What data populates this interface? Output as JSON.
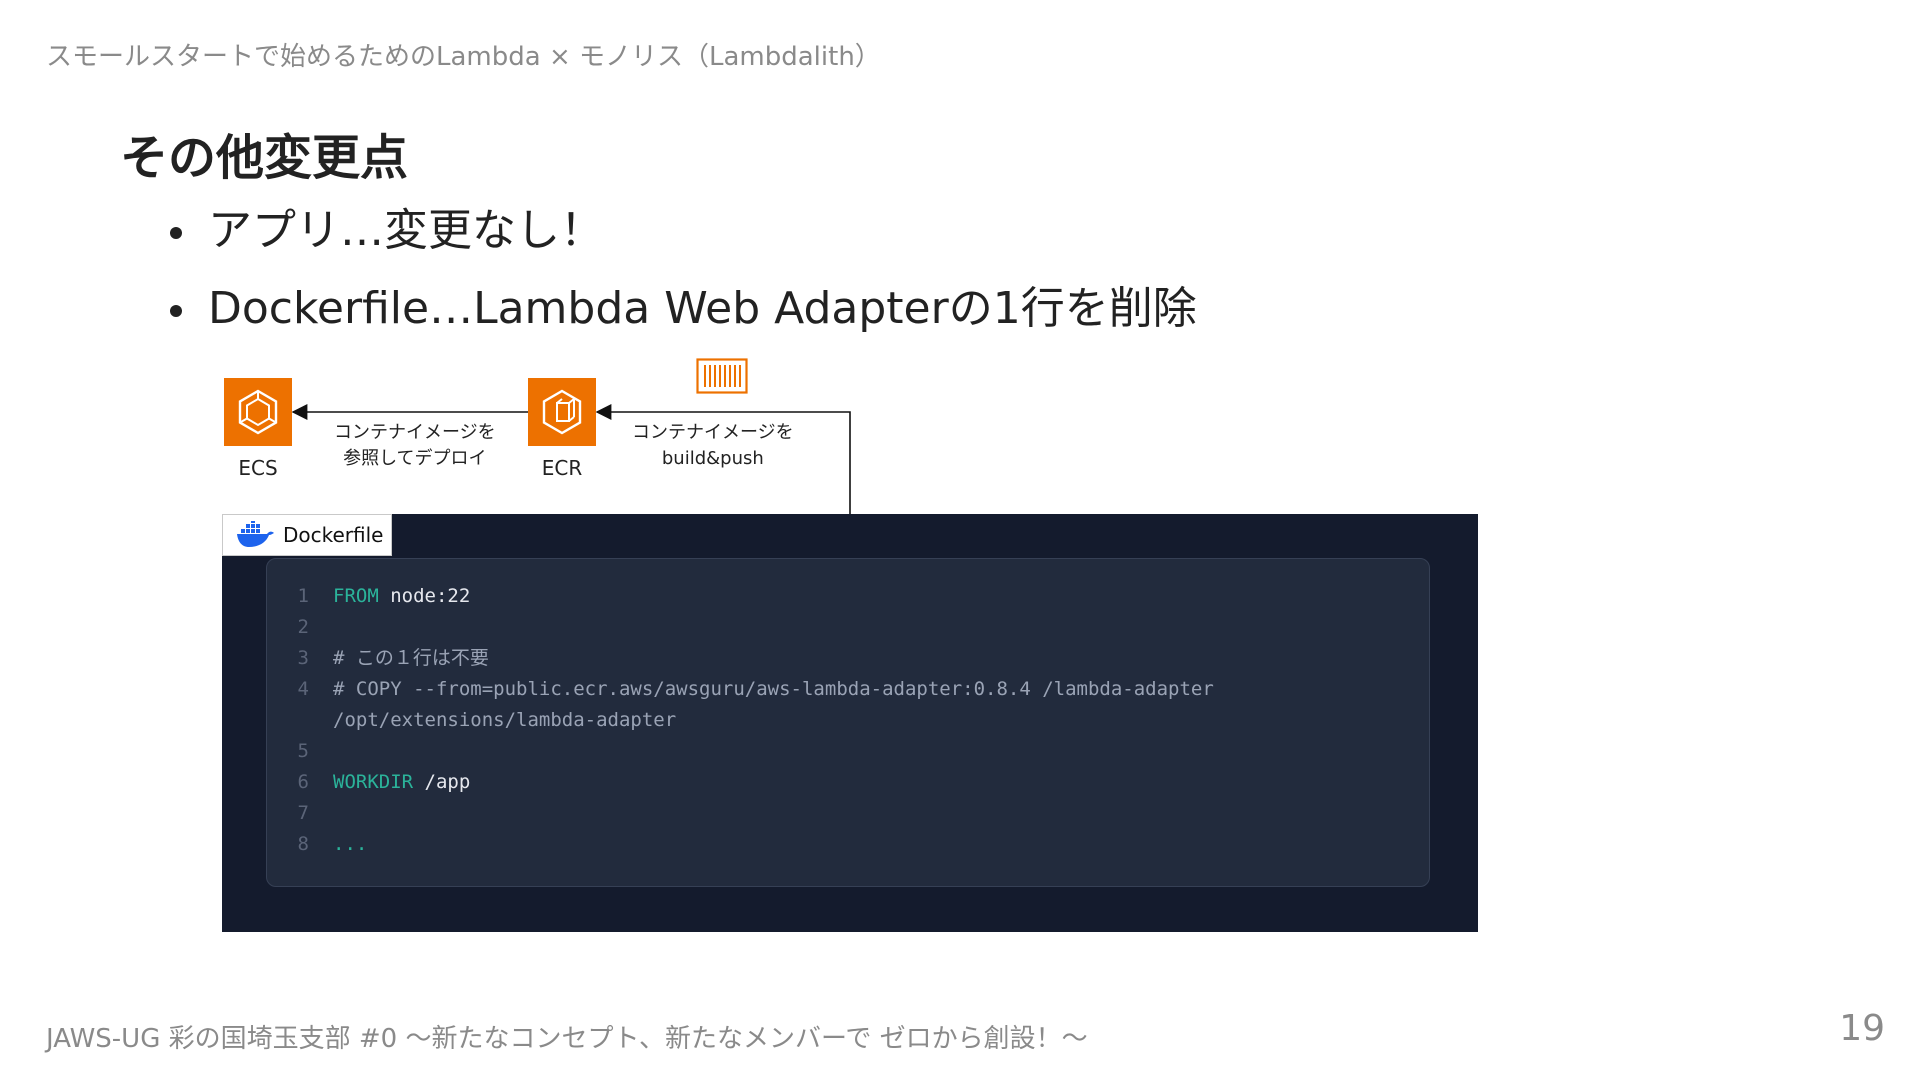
{
  "header": {
    "running_title": "スモールスタートで始めるためのLambda × モノリス（Lambdalith）"
  },
  "slide": {
    "heading": "その他変更点",
    "bullets": [
      "アプリ…変更なし！",
      "Dockerfile…Lambda Web Adapterの1行を削除"
    ]
  },
  "diagram": {
    "services": {
      "ecs": "ECS",
      "ecr": "ECR"
    },
    "edges": {
      "deploy_line1": "コンテナイメージを",
      "deploy_line2": "参照してデプロイ",
      "push_line1": "コンテナイメージを",
      "push_line2": "build&push"
    },
    "icons": [
      "ecs-icon",
      "ecr-icon",
      "container-image-icon",
      "docker-icon"
    ],
    "colors": {
      "aws_orange": "#ed7100",
      "docker_blue": "#1d63ed",
      "code_bg": "#141b2d",
      "keyword": "#2bb39a"
    }
  },
  "dockerfile": {
    "tab_label": "Dockerfile",
    "lines": [
      {
        "no": "1",
        "keyword": "FROM",
        "text": " node:22"
      },
      {
        "no": "2",
        "keyword": "",
        "text": ""
      },
      {
        "no": "3",
        "keyword": "",
        "comment": "# この１行は不要"
      },
      {
        "no": "4",
        "keyword": "",
        "comment": "# COPY --from=public.ecr.aws/awsguru/aws-lambda-adapter:0.8.4 /lambda-adapter"
      },
      {
        "no": "",
        "keyword": "",
        "comment": "/opt/extensions/lambda-adapter"
      },
      {
        "no": "5",
        "keyword": "",
        "text": ""
      },
      {
        "no": "6",
        "keyword": "WORKDIR",
        "text": " /app"
      },
      {
        "no": "7",
        "keyword": "",
        "text": ""
      },
      {
        "no": "8",
        "keyword": "...",
        "text": ""
      }
    ]
  },
  "footer": {
    "event_text": "JAWS-UG 彩の国埼玉支部 #0 〜新たなコンセプト、新たなメンバーで ゼロから創設！〜",
    "page_number": "19"
  }
}
